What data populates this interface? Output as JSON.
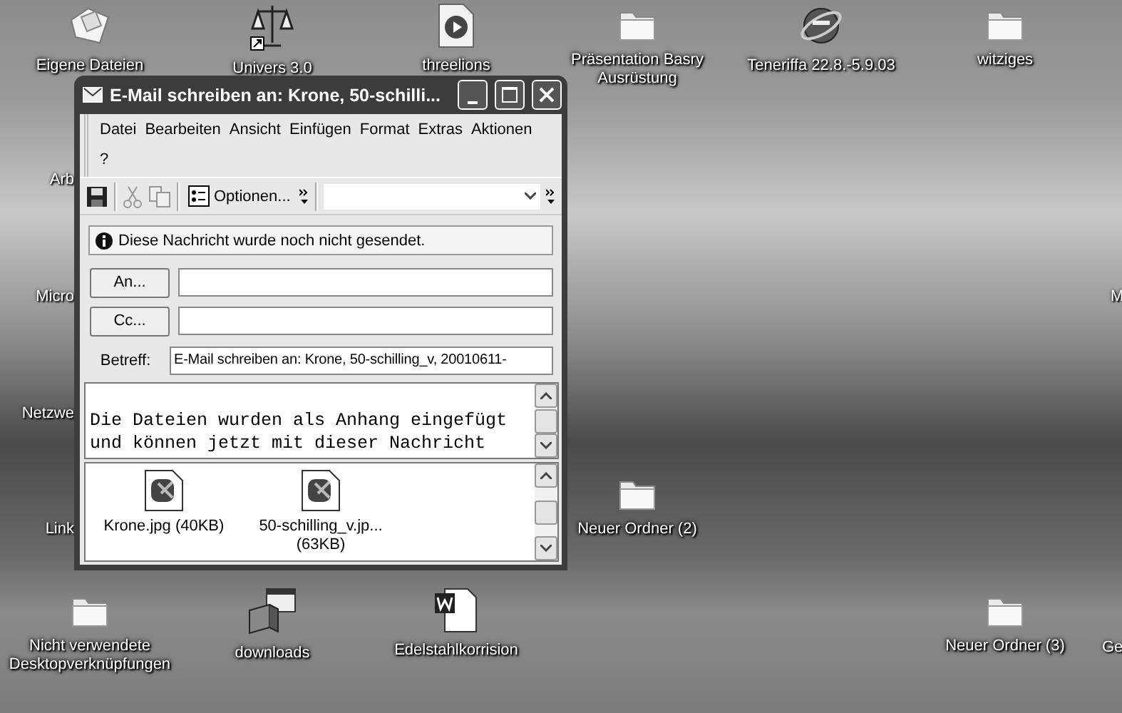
{
  "desktop": {
    "icons": [
      {
        "label": "Eigene Dateien",
        "kind": "documents"
      },
      {
        "label": "Univers 3.0",
        "kind": "shortcut"
      },
      {
        "label": "threelions",
        "kind": "media"
      },
      {
        "label": "Präsentation Basry Ausrüstung",
        "kind": "folder"
      },
      {
        "label": "Teneriffa 22.8.-5.9.03",
        "kind": "browser"
      },
      {
        "label": "witziges",
        "kind": "folder"
      },
      {
        "label": "Neuer Ordner (2)",
        "kind": "folder"
      },
      {
        "label": "Nicht verwendete Desktopverknüpfungen",
        "kind": "folder"
      },
      {
        "label": "downloads",
        "kind": "program"
      },
      {
        "label": "Edelstahlkorrision",
        "kind": "word"
      },
      {
        "label": "Neuer Ordner (3)",
        "kind": "folder"
      }
    ],
    "cut_labels": [
      "Arb",
      "Micro",
      "Netzwe",
      "Link",
      "M",
      "Ge"
    ]
  },
  "window": {
    "title": "E-Mail schreiben an: Krone, 50-schilli...",
    "menu": [
      [
        "Datei",
        "Bearbeiten",
        "Ansicht",
        "Einfügen",
        "Format",
        "Extras",
        "Aktionen"
      ],
      [
        "?"
      ]
    ],
    "toolbar": [
      {
        "kind": "save",
        "disabled": false
      },
      {
        "kind": "cut",
        "disabled": true
      },
      {
        "kind": "copy",
        "disabled": true
      }
    ],
    "options_button": "Optionen...",
    "info": "Diese Nachricht wurde noch nicht gesendet.",
    "to_button": "An...",
    "cc_button": "Cc...",
    "subject_label": "Betreff:",
    "subject": "E-Mail schreiben an: Krone, 50-schilling_v, 20010611-",
    "body_lines": [
      "Die Dateien wurden als Anhang eingefügt",
      "und können jetzt mit dieser Nachricht"
    ],
    "attachments": [
      {
        "label": "Krone.jpg (40KB)"
      },
      {
        "label": "50-schilling_v.jp... (63KB)"
      }
    ]
  }
}
